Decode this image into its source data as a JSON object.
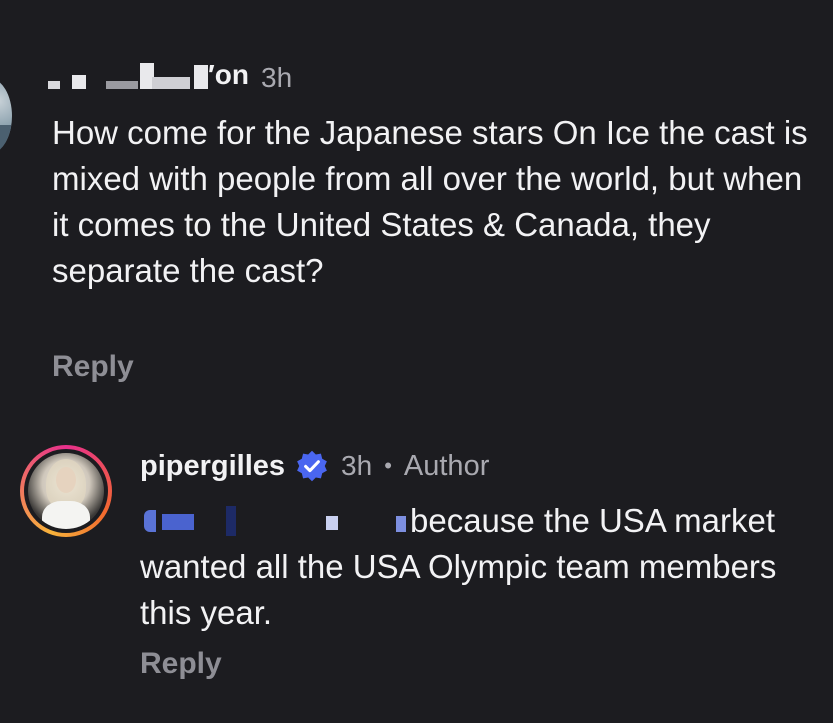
{
  "comment_1": {
    "username_suffix": "′on",
    "time": "3h",
    "text": "How come for the Japanese stars On Ice the cast is mixed with people from all over the world, but when it comes to the United States & Canada, they separate the cast?",
    "reply_label": "Reply"
  },
  "comment_2": {
    "username": "pipergilles",
    "time": "3h",
    "separator": "•",
    "badge": "Author",
    "text": "because the USA market wanted all the USA Olympic team members this year.",
    "reply_label": "Reply",
    "verified_color": "#4a66f0",
    "avatar_ring_colors": [
      "#e7308c",
      "#f26a2e",
      "#f7b23b"
    ]
  },
  "theme": {
    "background": "#1c1c20",
    "text_primary": "#f2f2f4",
    "text_secondary": "#a9a9b0",
    "reply_color": "#8e8e95"
  }
}
